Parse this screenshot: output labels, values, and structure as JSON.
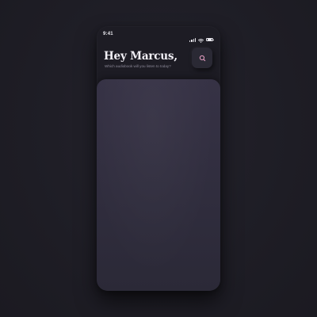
{
  "status_bar": {
    "time": "9:41",
    "icons": [
      "signal-icon",
      "wifi-icon",
      "battery-icon"
    ]
  },
  "header": {
    "greeting": "Hey Marcus,",
    "subtitle": "Which audiobook will you listen to today?",
    "search_icon": "search-icon"
  },
  "colors": {
    "background": "#1f1e26",
    "phone": "#1d1c24",
    "card": "#343042",
    "accent_pink": "#e8a0c4",
    "text_primary": "#f1eff5",
    "text_secondary": "#8d8a99"
  }
}
